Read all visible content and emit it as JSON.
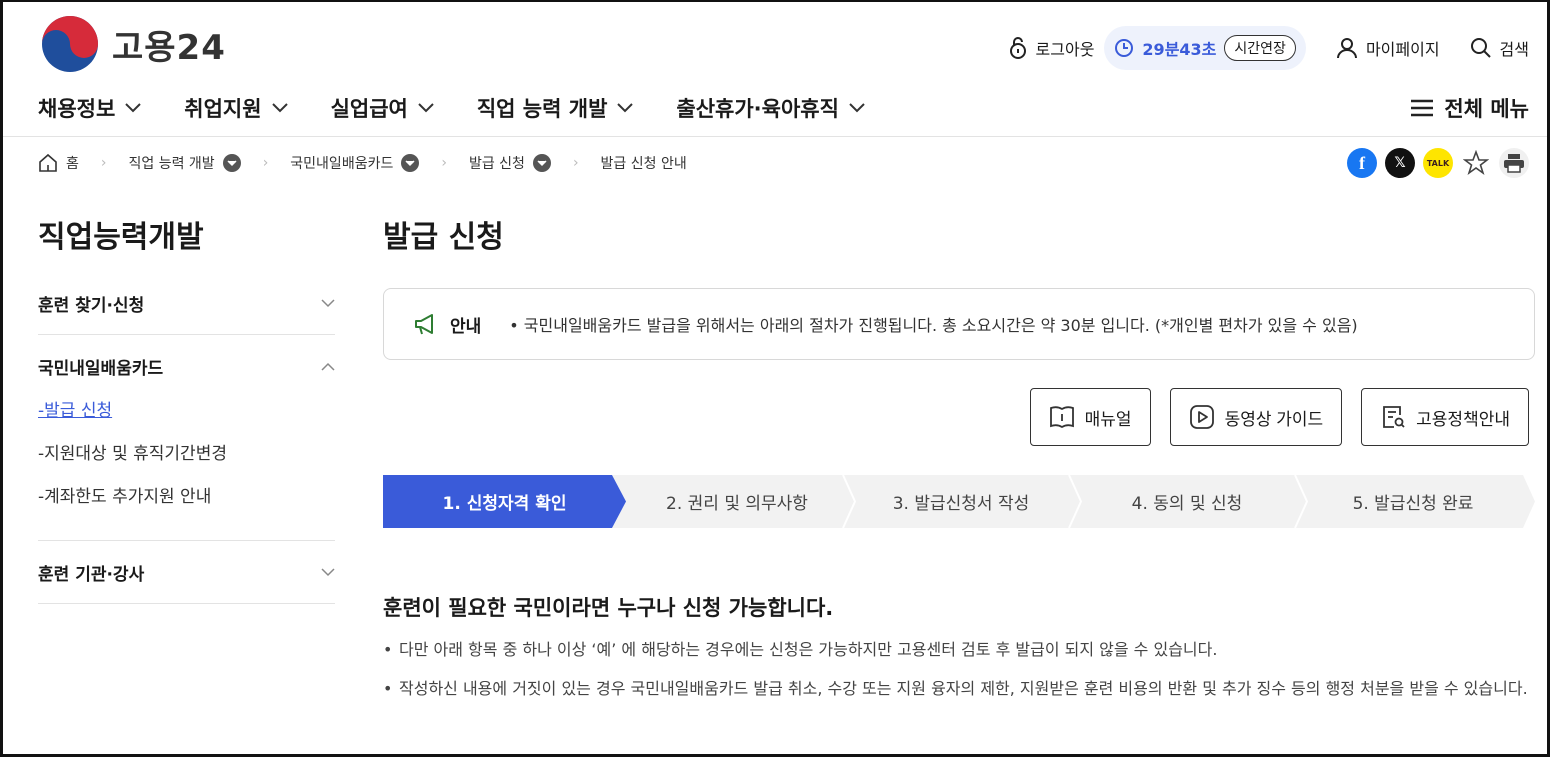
{
  "header": {
    "logo_text": "고용24",
    "logout_label": "로그아웃",
    "timer": "29분43초",
    "extend_label": "시간연장",
    "mypage_label": "마이페이지",
    "search_label": "검색"
  },
  "gnb": {
    "items": [
      "채용정보",
      "취업지원",
      "실업급여",
      "직업 능력 개발",
      "출산휴가·육아휴직"
    ],
    "all_menu_label": "전체 메뉴"
  },
  "breadcrumb": {
    "home": "홈",
    "items": [
      "직업 능력 개발",
      "국민내일배움카드",
      "발급 신청",
      "발급 신청 안내"
    ]
  },
  "sidebar": {
    "title": "직업능력개발",
    "groups": [
      {
        "label": "훈련 찾기·신청"
      },
      {
        "label": "국민내일배움카드",
        "subs": [
          "-발급 신청",
          "-지원대상 및 휴직기간변경",
          "-계좌한도 추가지원 안내"
        ]
      },
      {
        "label": "훈련 기관·강사"
      }
    ]
  },
  "main": {
    "title": "발급 신청",
    "notice_label": "안내",
    "notice_text": "• 국민내일배움카드 발급을 위해서는 아래의 절차가 진행됩니다. 총 소요시간은 약 30분 입니다. (*개인별 편차가 있을 수 있음)",
    "buttons": [
      "매뉴얼",
      "동영상 가이드",
      "고용정책안내"
    ],
    "steps": [
      "1. 신청자격 확인",
      "2. 권리 및 의무사항",
      "3. 발급신청서 작성",
      "4. 동의 및 신청",
      "5. 발급신청 완료"
    ],
    "active_step": 1,
    "heading": "훈련이 필요한 국민이라면 누구나 신청 가능합니다.",
    "bullets": [
      "다만 아래 항목 중 하나 이상 ‘예’ 에 해당하는 경우에는 신청은 가능하지만 고용센터 검토 후 발급이 되지 않을 수 있습니다.",
      "작성하신 내용에 거짓이 있는 경우 국민내일배움카드 발급 취소, 수강 또는 지원 융자의 제한, 지원받은 훈련 비용의 반환 및 추가 징수 등의 행정 처분을 받을 수 있습니다."
    ]
  },
  "colors": {
    "accent": "#3a5bd9",
    "step_active": "#3a5bd9",
    "step_inactive": "#f2f2f2"
  },
  "icons": [
    "lock-icon",
    "clock-icon",
    "person-icon",
    "search-icon",
    "chevron-down-icon",
    "hamburger-icon",
    "home-icon",
    "facebook-icon",
    "x-icon",
    "kakaotalk-icon",
    "star-icon",
    "print-icon",
    "megaphone-icon",
    "book-icon",
    "play-icon",
    "document-search-icon"
  ]
}
